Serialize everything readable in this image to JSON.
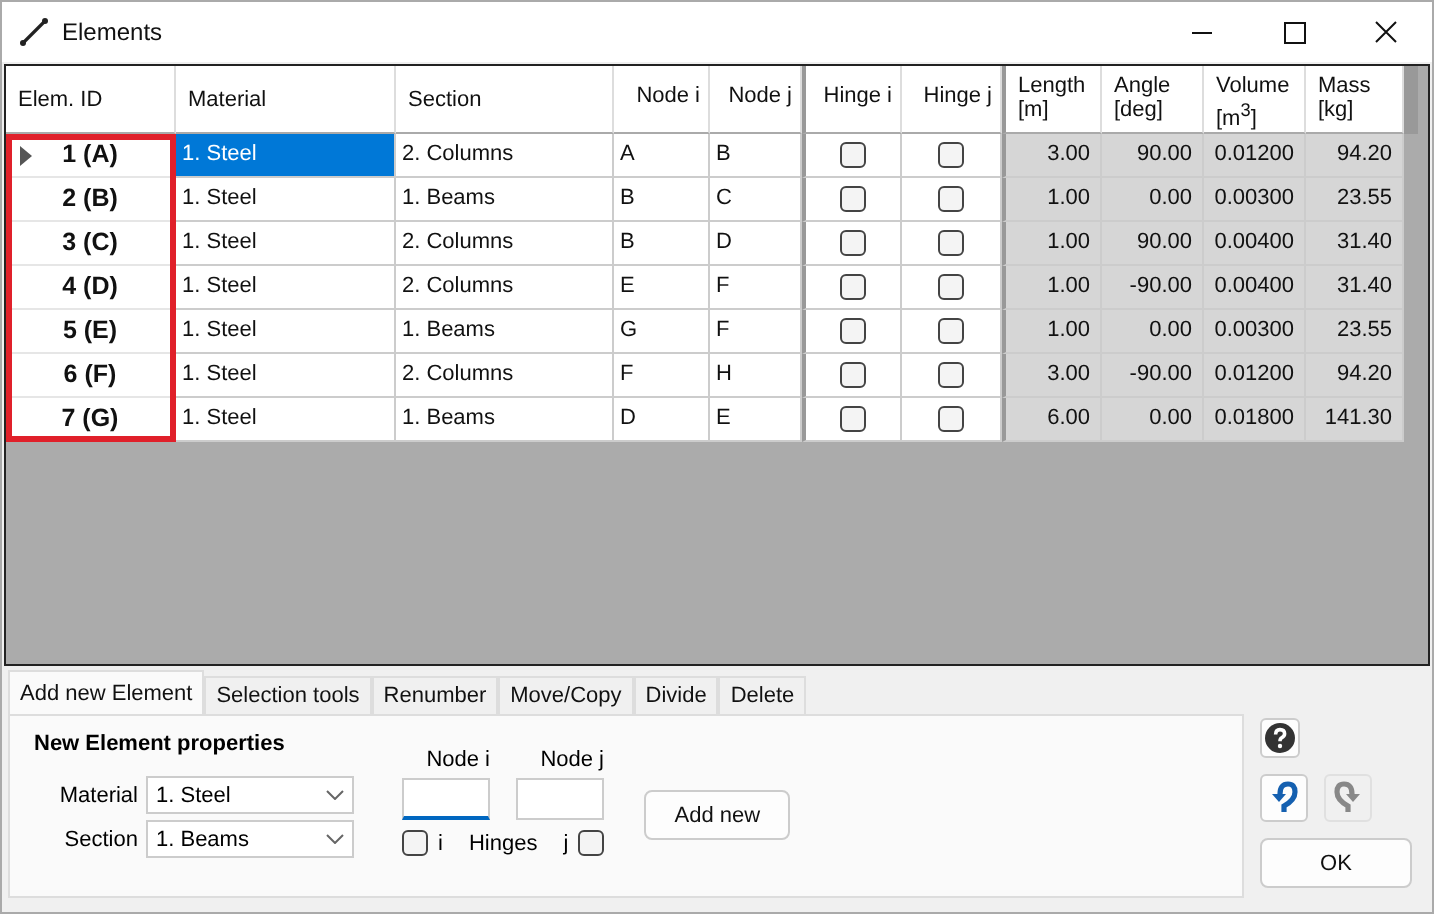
{
  "window": {
    "title": "Elements"
  },
  "table": {
    "columns": [
      {
        "label": "Elem. ID",
        "highlighted": true
      },
      {
        "label": "Material",
        "highlighted": false
      },
      {
        "label": "Section",
        "highlighted": false
      },
      {
        "label": "Node i",
        "highlighted": false
      },
      {
        "label": "Node j",
        "highlighted": false
      },
      {
        "label": "Hinge i",
        "highlighted": false
      },
      {
        "label": "Hinge j",
        "highlighted": false
      },
      {
        "label": "Length [m]",
        "highlighted": false
      },
      {
        "label": "Angle [deg]",
        "highlighted": false
      },
      {
        "label": "Volume [m$^{3}$]",
        "highlighted": false
      },
      {
        "label": "Mass [kg]",
        "highlighted": false
      }
    ],
    "rows": [
      {
        "selected": true,
        "id": "1 (A)",
        "material": "1. Steel",
        "section": "2. Columns",
        "node_i": "A",
        "node_j": "B",
        "hinge_i": false,
        "hinge_j": false,
        "length": "3.00",
        "angle": "90.00",
        "volume": "0.01200",
        "mass": "94.20"
      },
      {
        "selected": false,
        "id": "2 (B)",
        "material": "1. Steel",
        "section": "1. Beams",
        "node_i": "B",
        "node_j": "C",
        "hinge_i": false,
        "hinge_j": false,
        "length": "1.00",
        "angle": "0.00",
        "volume": "0.00300",
        "mass": "23.55"
      },
      {
        "selected": false,
        "id": "3 (C)",
        "material": "1. Steel",
        "section": "2. Columns",
        "node_i": "B",
        "node_j": "D",
        "hinge_i": false,
        "hinge_j": false,
        "length": "1.00",
        "angle": "90.00",
        "volume": "0.00400",
        "mass": "31.40"
      },
      {
        "selected": false,
        "id": "4 (D)",
        "material": "1. Steel",
        "section": "2. Columns",
        "node_i": "E",
        "node_j": "F",
        "hinge_i": false,
        "hinge_j": false,
        "length": "1.00",
        "angle": "-90.00",
        "volume": "0.00400",
        "mass": "31.40"
      },
      {
        "selected": false,
        "id": "5 (E)",
        "material": "1. Steel",
        "section": "1. Beams",
        "node_i": "G",
        "node_j": "F",
        "hinge_i": false,
        "hinge_j": false,
        "length": "1.00",
        "angle": "0.00",
        "volume": "0.00300",
        "mass": "23.55"
      },
      {
        "selected": false,
        "id": "6 (F)",
        "material": "1. Steel",
        "section": "2. Columns",
        "node_i": "F",
        "node_j": "H",
        "hinge_i": false,
        "hinge_j": false,
        "length": "3.00",
        "angle": "-90.00",
        "volume": "0.01200",
        "mass": "94.20"
      },
      {
        "selected": false,
        "id": "7 (G)",
        "material": "1. Steel",
        "section": "1. Beams",
        "node_i": "D",
        "node_j": "E",
        "hinge_i": false,
        "hinge_j": false,
        "length": "6.00",
        "angle": "0.00",
        "volume": "0.01800",
        "mass": "141.30"
      }
    ]
  },
  "tabs": [
    {
      "label": "Add new Element",
      "selected": true
    },
    {
      "label": "Selection tools",
      "selected": false
    },
    {
      "label": "Renumber",
      "selected": false
    },
    {
      "label": "Move/Copy",
      "selected": false
    },
    {
      "label": "Divide",
      "selected": false
    },
    {
      "label": "Delete",
      "selected": false
    }
  ],
  "form": {
    "title": "New Element properties",
    "material": {
      "label": "Material",
      "value": "1. Steel"
    },
    "section": {
      "label": "Section",
      "value": "1. Beams"
    },
    "node_i": {
      "label": "Node i",
      "focused": true
    },
    "node_j": {
      "label": "Node j",
      "focused": false
    },
    "hinge_i": {
      "label": "i",
      "checked": false
    },
    "hinges_label": "Hinges",
    "hinge_j": {
      "label": "j",
      "checked": false
    },
    "add_button": "Add new"
  },
  "side": {
    "undo_enabled": true,
    "redo_enabled": false,
    "ok_button": "OK"
  }
}
